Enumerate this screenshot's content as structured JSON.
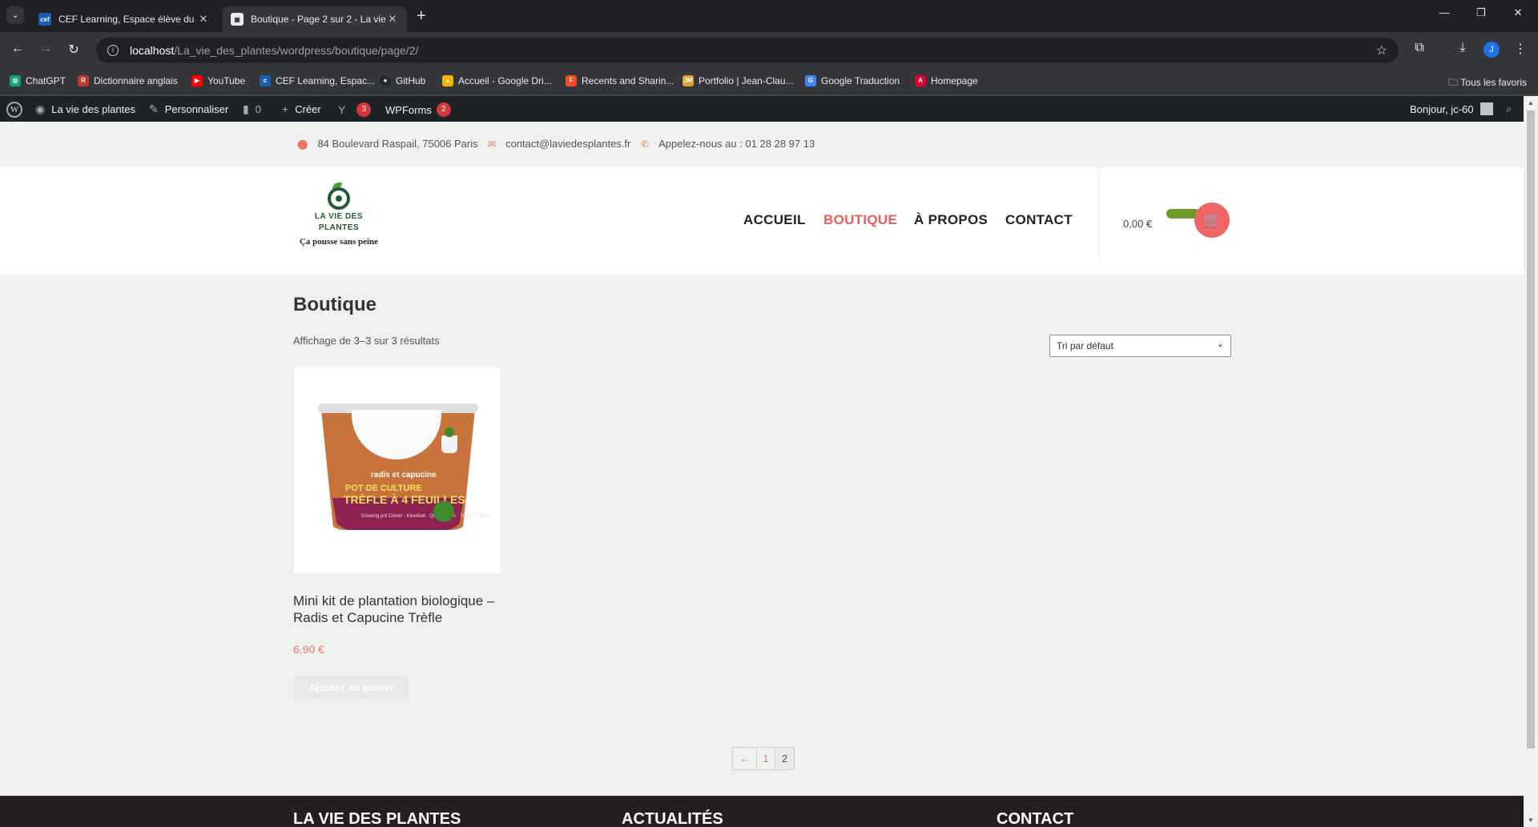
{
  "browser": {
    "tabs": [
      {
        "title": "CEF Learning, Espace élève du C",
        "favicon": "CEF"
      },
      {
        "title": "Boutique - Page 2 sur 2 - La vie",
        "favicon": "page-icon"
      }
    ],
    "url_host": "localhost",
    "url_path": "/La_vie_des_plantes/wordpress/boutique/page/2/",
    "profile_initial": "J",
    "bookmarks": [
      {
        "label": "ChatGPT",
        "color": "#10a37f"
      },
      {
        "label": "Dictionnaire anglais",
        "color": "#c0392b"
      },
      {
        "label": "YouTube",
        "color": "#ff0000"
      },
      {
        "label": "CEF Learning, Espac...",
        "color": "#1a5fb4"
      },
      {
        "label": "GitHub",
        "color": "#24292e"
      },
      {
        "label": "Accueil - Google Dri...",
        "color": "#f4b400"
      },
      {
        "label": "Recents and Sharin...",
        "color": "#f24e1e"
      },
      {
        "label": "Portfolio | Jean-Clau...",
        "color": "#e0a030"
      },
      {
        "label": "Google Traduction",
        "color": "#4285f4"
      },
      {
        "label": "Homepage",
        "color": "#dd0031"
      }
    ],
    "all_bookmarks": "Tous les favoris"
  },
  "admin_bar": {
    "site_name": "La vie des plantes",
    "customize": "Personnaliser",
    "comments": "0",
    "create": "Créer",
    "yoast_count": "3",
    "wpforms": "WPForms",
    "wpforms_count": "2",
    "greeting": "Bonjour, jc-60"
  },
  "topinfo": {
    "address": "84 Boulevard Raspail, 75006 Paris",
    "email": "contact@laviedesplantes.fr",
    "phone": "Appelez-nous au : 01 28 28 97 13"
  },
  "header": {
    "logo_line1": "LA VIE DES",
    "logo_line2": "PLANTES",
    "tagline": "Ça pousse sans peine",
    "menu": [
      "ACCUEIL",
      "BOUTIQUE",
      "À PROPOS",
      "CONTACT"
    ],
    "active_menu": "BOUTIQUE",
    "cart_total": "0,00 €"
  },
  "shop": {
    "title": "Boutique",
    "result_count": "Affichage de 3–3 sur 3 résultats",
    "sort_selected": "Tri par défaut",
    "products": [
      {
        "title": "Mini kit de plantation biologique – Radis et Capucine Trèfle",
        "price": "6,90 €",
        "button": "Ajouter au panier",
        "image_text": {
          "brand": "radis et capucine",
          "line1": "POT DE CULTURE",
          "line2": "TRÈFLE À 4 FEUILLES",
          "small": "Growing pot Clover · Kleeblatt · Quadrifoglio · Trevo · Trébol"
        }
      }
    ],
    "pagination": {
      "prev": "←",
      "pages": [
        "1",
        "2"
      ],
      "current": "2"
    }
  },
  "footer": {
    "columns": [
      "LA VIE DES PLANTES",
      "ACTUALITÉS",
      "CONTACT"
    ]
  }
}
